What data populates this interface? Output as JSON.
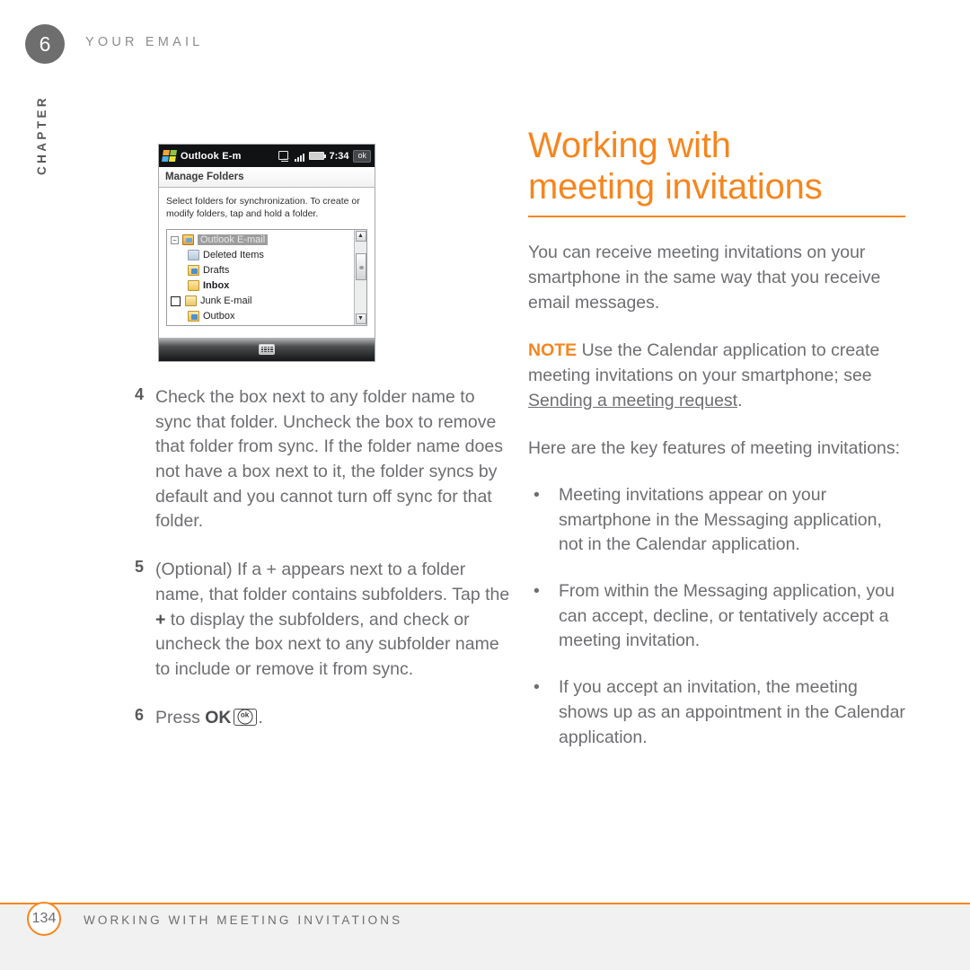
{
  "header": {
    "chapter_number": "6",
    "running_head": "YOUR EMAIL",
    "chapter_word": "CHAPTER"
  },
  "device": {
    "app_title": "Outlook E-m",
    "time": "7:34",
    "ok_button": "ok",
    "screen_header": "Manage Folders",
    "instructions": "Select folders for synchronization. To create or modify folders, tap and hold a folder.",
    "tree": [
      {
        "label": "Outlook E-mail",
        "icon": "mail-account-icon",
        "selected": true,
        "expander": "−",
        "checkbox": false,
        "bold": false,
        "indent": false
      },
      {
        "label": "Deleted Items",
        "icon": "deleted-items-folder-icon",
        "selected": false,
        "expander": "",
        "checkbox": false,
        "bold": false,
        "indent": true
      },
      {
        "label": "Drafts",
        "icon": "drafts-folder-icon",
        "selected": false,
        "expander": "",
        "checkbox": false,
        "bold": false,
        "indent": true
      },
      {
        "label": "Inbox",
        "icon": "inbox-folder-icon",
        "selected": false,
        "expander": "",
        "checkbox": false,
        "bold": true,
        "indent": true
      },
      {
        "label": "Junk E-mail",
        "icon": "junk-folder-icon",
        "selected": false,
        "expander": "",
        "checkbox": true,
        "bold": false,
        "indent": true
      },
      {
        "label": "Outbox",
        "icon": "outbox-folder-icon",
        "selected": false,
        "expander": "",
        "checkbox": false,
        "bold": false,
        "indent": true
      }
    ]
  },
  "steps": [
    {
      "number": "4",
      "text": "Check the box next to any folder name to sync that folder. Uncheck the box to remove that folder from sync. If the folder name does not have a box next to it, the folder syncs by default and you cannot turn off sync for that folder."
    },
    {
      "number": "5",
      "text_before": "(Optional) If a + appears next to a folder name, that folder contains subfolders. Tap the ",
      "bold_plus": "+",
      "text_after": " to display the subfolders, and check or uncheck the box next to any subfolder name to include or remove it from sync."
    },
    {
      "number": "6",
      "text_before": "Press ",
      "bold_ok": "OK",
      "key_icon": "ok-key-icon",
      "text_after": "."
    }
  ],
  "right": {
    "headline_line1": "Working with",
    "headline_line2": "meeting invitations",
    "intro": "You can receive meeting invitations on your smartphone in the same way that you receive email messages.",
    "note_label": "NOTE",
    "note_text_before": " Use the Calendar application to create meeting invitations on your smartphone; see ",
    "note_xref": "Sending a meeting request",
    "note_text_after": ".",
    "lead_in": "Here are the key features of meeting invitations:",
    "bullets": [
      {
        "dot": "•",
        "text": "Meeting invitations appear on your smartphone in the Messaging application, not in the Calendar application."
      },
      {
        "dot": "•",
        "text": "From within the Messaging application, you can accept, decline, or tentatively accept a meeting invitation."
      },
      {
        "dot": "•",
        "text": "If you accept an invitation, the meeting shows up as an appointment in the Calendar application."
      }
    ]
  },
  "footer": {
    "page_number": "134",
    "title": "WORKING WITH MEETING INVITATIONS"
  },
  "colors": {
    "accent_orange": "#F5861F",
    "body_gray": "#6D6E71",
    "chapter_badge_gray": "#6E6E6E",
    "footer_band": "#F1F1F1"
  }
}
